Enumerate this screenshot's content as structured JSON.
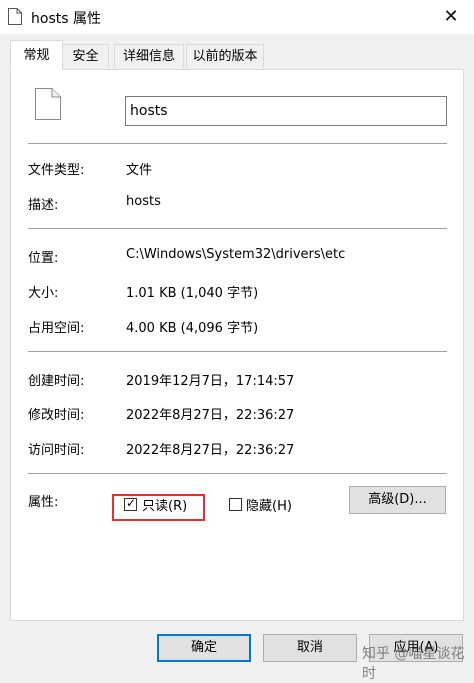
{
  "window": {
    "title": "hosts 属性",
    "close_label": "✕"
  },
  "tabs": [
    {
      "label": "常规"
    },
    {
      "label": "安全"
    },
    {
      "label": "详细信息"
    },
    {
      "label": "以前的版本"
    }
  ],
  "general": {
    "file_name": "hosts",
    "rows": [
      {
        "label": "文件类型:",
        "value": "文件"
      },
      {
        "label": "描述:",
        "value": "hosts"
      },
      {
        "label": "位置:",
        "value": "C:\\Windows\\System32\\drivers\\etc"
      },
      {
        "label": "大小:",
        "value": "1.01 KB (1,040 字节)"
      },
      {
        "label": "占用空间:",
        "value": "4.00 KB (4,096 字节)"
      },
      {
        "label": "创建时间:",
        "value": "2019年12月7日，17:14:57"
      },
      {
        "label": "修改时间:",
        "value": "2022年8月27日，22:36:27"
      },
      {
        "label": "访问时间:",
        "value": "2022年8月27日，22:36:27"
      }
    ],
    "attributes": {
      "label": "属性:",
      "readonly": {
        "label": "只读(R)",
        "checked": true
      },
      "hidden": {
        "label": "隐藏(H)",
        "checked": false
      },
      "advanced_button": "高级(D)..."
    }
  },
  "footer": {
    "ok": "确定",
    "cancel": "取消",
    "apply": "应用(A)"
  },
  "watermark": "知乎 @喵星谈花时"
}
